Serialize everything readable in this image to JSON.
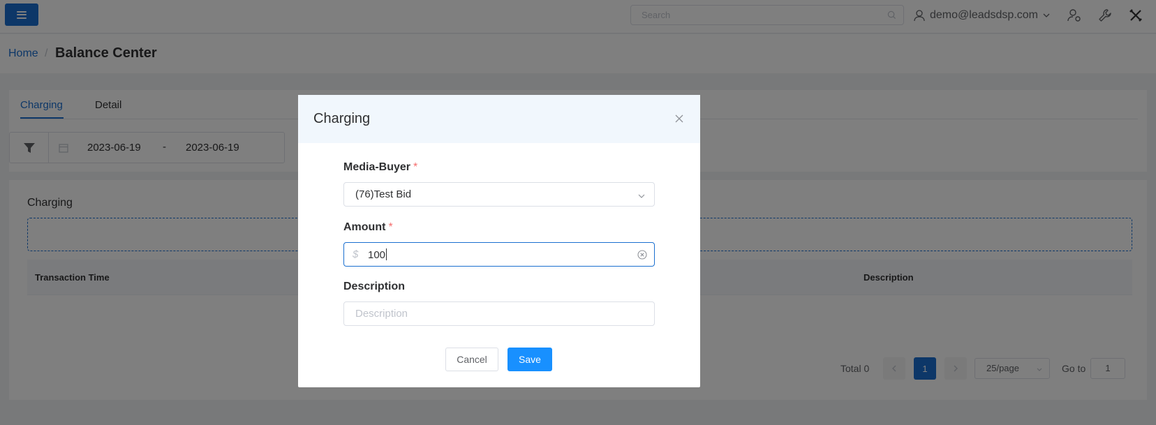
{
  "header": {
    "search_placeholder": "Search",
    "user_email": "demo@leadsdsp.com"
  },
  "breadcrumb": {
    "home": "Home",
    "separator": "/",
    "current": "Balance Center"
  },
  "tabs": [
    {
      "label": "Charging",
      "active": true
    },
    {
      "label": "Detail",
      "active": false
    }
  ],
  "filter": {
    "start_date": "2023-06-19",
    "separator": "-",
    "end_date": "2023-06-19"
  },
  "charging_section": {
    "title": "Charging",
    "columns": [
      "Transaction Time",
      "Description"
    ]
  },
  "pagination": {
    "total": "Total 0",
    "current_page": "1",
    "page_size": "25/page",
    "goto_label": "Go to",
    "goto_value": "1"
  },
  "dialog": {
    "title": "Charging",
    "media_buyer_label": "Media-Buyer",
    "media_buyer_value": "(76)Test Bid",
    "amount_label": "Amount",
    "amount_prefix": "$",
    "amount_value": "100",
    "description_label": "Description",
    "description_placeholder": "Description",
    "required_mark": "*",
    "cancel_label": "Cancel",
    "save_label": "Save"
  },
  "colors": {
    "primary": "#1a6fd0",
    "save_button": "#1890ff",
    "required": "#f56c6c",
    "dialog_header_bg": "#f1f7fd"
  }
}
